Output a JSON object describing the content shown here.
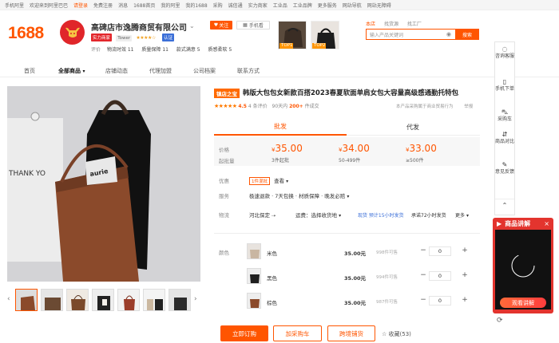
{
  "topbar": {
    "items": [
      "手机阿里",
      "欢迎来到阿里巴巴",
      "请登录",
      "免费注册",
      "消息",
      "1688首页",
      "我的阿里",
      "我的1688",
      "采购",
      "诚信通",
      "实力商家",
      "工业品",
      "工业品牌",
      "更多服务",
      "网站导航",
      "网站无障碍"
    ],
    "highlight_index": 2
  },
  "header": {
    "logo": "1688",
    "shop_name": "高碑店市逸腾商贸有限公司",
    "badges": [
      "实力商家",
      "Tower",
      "认证"
    ],
    "follow_label": "关注",
    "phone_label": "手机看",
    "metrics_label": "评价",
    "metrics": [
      "物流时效 11",
      "质量保障 11",
      "款式满意 5",
      "质感柔软 5"
    ],
    "top_labels": [
      "TOP1",
      "TOP2"
    ]
  },
  "search": {
    "tabs": [
      "本店",
      "找货源",
      "找工厂"
    ],
    "placeholder": "输入产品关键词",
    "button": "搜索"
  },
  "nav": {
    "items": [
      "首页",
      "全部商品",
      "店铺动态",
      "代理加盟",
      "公司档案",
      "联系方式"
    ],
    "active_index": 1
  },
  "product": {
    "tag": "镇店之宝",
    "title": "韩版大包包女新款百搭2023春夏软面单肩女包大容量高级感通勤托特包",
    "rating": "4.5",
    "rating_count": "4 条评价",
    "sold_label": "90天内",
    "sold_count": "200+",
    "sold_suffix": "件成交",
    "right_note": "本产品采购属于商业贸易行为",
    "report": "举报",
    "thumb_count": 7
  },
  "price_tabs": [
    "批发",
    "代发"
  ],
  "pricing": {
    "label_price": "价格",
    "label_qty": "起批量",
    "tiers": [
      {
        "currency": "¥",
        "price": "35.00",
        "qty": "3件起批"
      },
      {
        "currency": "¥",
        "price": "34.00",
        "qty": "50-499件"
      },
      {
        "currency": "¥",
        "price": "33.00",
        "qty": "≥500件"
      }
    ]
  },
  "details": {
    "promo_label": "优惠",
    "promo_chip": "1件混批",
    "promo_more": "查看",
    "service_label": "服务",
    "service_text": "极速退款 · 7天包换 · 材质保障 · 晚发必赔",
    "shipping_label": "物流",
    "shipping_from": "河北保定",
    "shipping_to": "运费：选择收货地",
    "shipping_promise": "现货 预计15小时发货",
    "shipping_guarantee": "承诺72小时发货",
    "shipping_more": "更多"
  },
  "sku": {
    "label": "颜色",
    "rows": [
      {
        "name": "米色",
        "price": "35.00元",
        "stock": "998件可售",
        "qty": "0"
      },
      {
        "name": "黑色",
        "price": "35.00元",
        "stock": "994件可售",
        "qty": "0"
      },
      {
        "name": "棕色",
        "price": "35.00元",
        "stock": "987件可售",
        "qty": "0"
      }
    ]
  },
  "actions": {
    "order": "立即订购",
    "cart": "加采购车",
    "dropship": "跨境铺货",
    "favorite": "收藏(53)"
  },
  "sidebar": {
    "items": [
      "咨询客服",
      "手机下单",
      "采购车",
      "商品对比",
      "意见反馈"
    ]
  },
  "live": {
    "title": "商品讲解",
    "button": "观看讲解"
  },
  "colors": {
    "accent": "#ff5500"
  }
}
